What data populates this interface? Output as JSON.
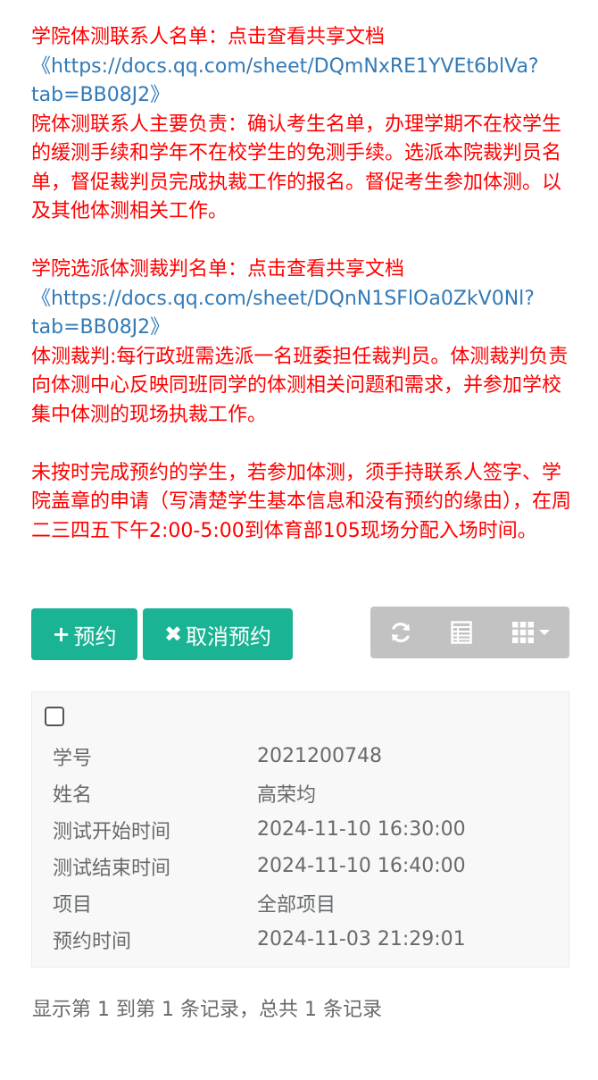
{
  "notice": {
    "line1": "学院体测联系人名单：点击查看共享文档",
    "link1": "《https://docs.qq.com/sheet/DQmNxRE1YVEt6blVa?tab=BB08J2》",
    "para1": "院体测联系人主要负责：确认考生名单，办理学期不在校学生的缓测手续和学年不在校学生的免测手续。选派本院裁判员名单，督促裁判员完成执裁工作的报名。督促考生参加体测。以及其他体测相关工作。",
    "line2": "学院选派体测裁判名单：点击查看共享文档",
    "link2": "《https://docs.qq.com/sheet/DQnN1SFlOa0ZkV0Nl?tab=BB08J2》",
    "para2": "体测裁判:每行政班需选派一名班委担任裁判员。体测裁判负责向体测中心反映同班同学的体测相关问题和需求，并参加学校集中体测的现场执裁工作。",
    "para3": "未按时完成预约的学生，若参加体测，须手持联系人签字、学院盖章的申请（写清楚学生基本信息和没有预约的缘由），在周二三四五下午2:00-5:00到体育部105现场分配入场时间。"
  },
  "toolbar": {
    "reserve_label": "预约",
    "reserve_icon": "+",
    "cancel_label": "取消预约",
    "cancel_icon": "✖",
    "accent_color": "#1ab394",
    "tools": [
      "refresh-icon",
      "toggle-view-icon",
      "columns-icon"
    ]
  },
  "record": {
    "fields": [
      {
        "label": "学号",
        "value": "2021200748"
      },
      {
        "label": "姓名",
        "value": "高荣均"
      },
      {
        "label": "测试开始时间",
        "value": "2024-11-10 16:30:00"
      },
      {
        "label": "测试结束时间",
        "value": "2024-11-10 16:40:00"
      },
      {
        "label": "项目",
        "value": "全部项目"
      },
      {
        "label": "预约时间",
        "value": "2024-11-03 21:29:01"
      }
    ]
  },
  "pagination": {
    "summary": "显示第 1 到第 1 条记录，总共 1 条记录"
  }
}
